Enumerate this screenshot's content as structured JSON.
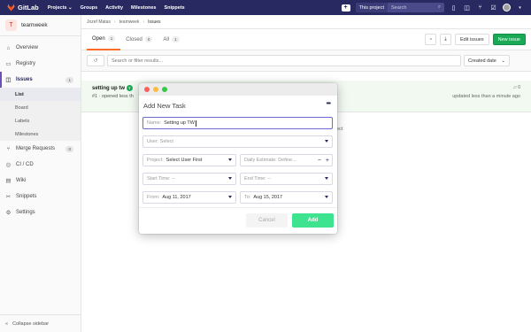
{
  "topbar": {
    "brand": "GitLab",
    "nav": [
      "Projects",
      "Groups",
      "Activity",
      "Milestones",
      "Snippets"
    ],
    "scope_label": "This project",
    "search_placeholder": "Search"
  },
  "sidebar": {
    "project_initial": "T",
    "project_name": "teamweek",
    "items": [
      {
        "label": "Overview",
        "icon": "home-icon"
      },
      {
        "label": "Registry",
        "icon": "registry-icon"
      },
      {
        "label": "Issues",
        "icon": "issues-icon",
        "count": "1",
        "active": true
      },
      {
        "label": "Merge Requests",
        "icon": "merge-request-icon",
        "count": "0"
      },
      {
        "label": "CI / CD",
        "icon": "pipeline-icon"
      },
      {
        "label": "Wiki",
        "icon": "wiki-icon"
      },
      {
        "label": "Snippets",
        "icon": "snippets-icon"
      },
      {
        "label": "Settings",
        "icon": "gear-icon"
      }
    ],
    "subitems": [
      "List",
      "Board",
      "Labels",
      "Milestones"
    ],
    "collapse_label": "Collapse sidebar"
  },
  "breadcrumb": [
    "Jozef Matas",
    "teamweek",
    "Issues"
  ],
  "tabs": [
    {
      "label": "Open",
      "count": "1"
    },
    {
      "label": "Closed",
      "count": "0"
    },
    {
      "label": "All",
      "count": "1"
    }
  ],
  "actions": {
    "edit": "Edit issues",
    "new": "New issue"
  },
  "filter": {
    "placeholder": "Search or filter results...",
    "sort": "Created date"
  },
  "issue": {
    "title": "setting up tw",
    "meta": "#1 · opened less th",
    "comments": "0",
    "updated": "updated less than a minute ago",
    "behind_text": "ect"
  },
  "modal": {
    "title": "Add New Task",
    "name_label": "Name:",
    "name_value": "Setting up TW",
    "user_label": "User: Select",
    "project_label": "Project:",
    "project_value": "Select User First",
    "estimate_label": "Daily Estimate: Define...",
    "start_label": "Start Time: --",
    "end_label": "End Time: --",
    "from_label": "From:",
    "from_value": "Aug 11, 2017",
    "to_label": "To:",
    "to_value": "Aug 15, 2017",
    "cancel": "Cancel",
    "add": "Add"
  },
  "colors": {
    "topbar": "#292961",
    "accent_green": "#1aaa55",
    "modal_add": "#3ee38f"
  }
}
